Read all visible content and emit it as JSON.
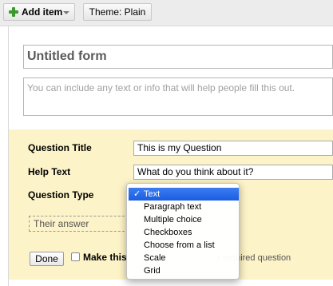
{
  "toolbar": {
    "add_item_label": "Add item",
    "theme_label": "Theme:  Plain"
  },
  "form": {
    "title_placeholder": "Untitled form",
    "description_placeholder": "You can include any text or info that will help people fill this out."
  },
  "question": {
    "title_label": "Question Title",
    "title_value": "This is my Question",
    "help_label": "Help Text",
    "help_value": "What do you think about it?",
    "type_label": "Question Type",
    "answer_preview": "Their answer",
    "done_label": "Done",
    "required_label": "Make this",
    "required_rest": "a required question"
  },
  "type_menu": {
    "selected_index": 0,
    "check": "✓",
    "items": [
      "Text",
      "Paragraph text",
      "Multiple choice",
      "Checkboxes",
      "Choose from a list",
      "Scale",
      "Grid"
    ]
  },
  "colors": {
    "accent_selected": "#1a5ee0",
    "editor_bg": "#fdf3c8",
    "plus_green": "#3a9b2c"
  }
}
